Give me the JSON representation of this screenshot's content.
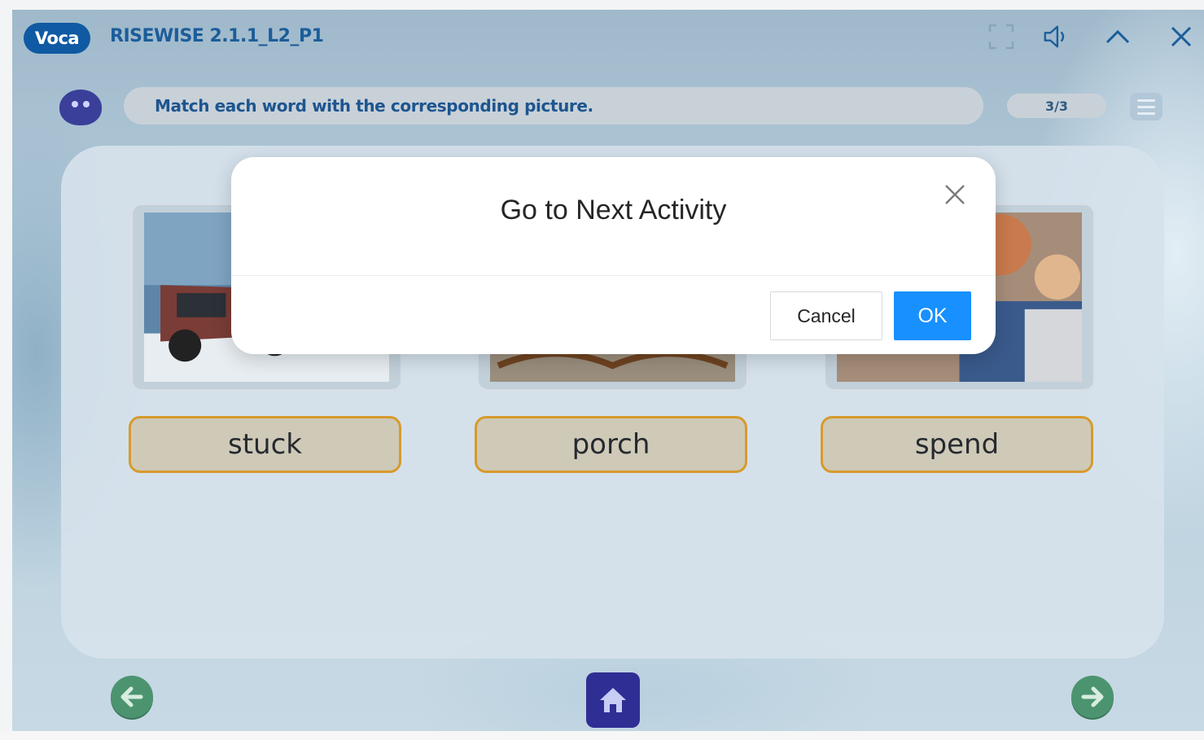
{
  "header": {
    "brand": "Voca",
    "title": "RISEWISE 2.1.1_L2_P1",
    "icons": [
      "fullscreen-icon",
      "speaker-icon",
      "chevron-up-icon",
      "close-icon"
    ]
  },
  "instruction": {
    "text": "Match each word with the corresponding picture.",
    "progress": "3/3"
  },
  "activity": {
    "cards": [
      {
        "image": "car-stuck-in-snow-photo"
      },
      {
        "image": "rocking-chairs-porch-photo"
      },
      {
        "image": "family-spending-time-photo"
      }
    ],
    "words": [
      "stuck",
      "porch",
      "spend"
    ]
  },
  "dialog": {
    "title": "Go to Next Activity",
    "cancel_label": "Cancel",
    "ok_label": "OK"
  },
  "colors": {
    "brand": "#0f5aa3",
    "ok_button": "#1890ff",
    "word_border": "#d79a2c",
    "nav_green": "#4c9470",
    "home_purple": "#2f2e94"
  }
}
